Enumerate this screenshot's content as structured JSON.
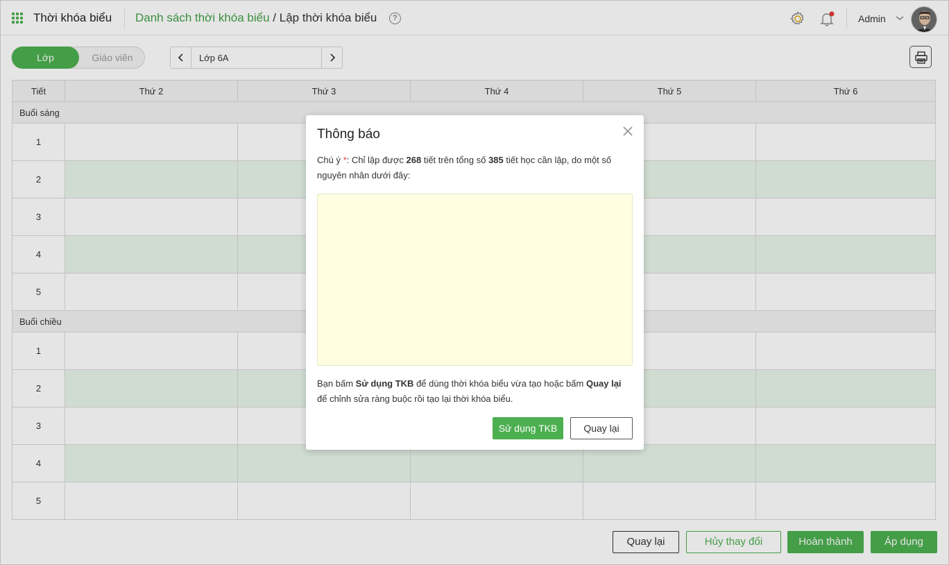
{
  "header": {
    "app_title": "Thời khóa biểu",
    "breadcrumb_link": "Danh sách thời khóa biểu",
    "breadcrumb_sep": " / ",
    "breadcrumb_current": "Lập thời khóa biểu",
    "help_glyph": "?",
    "user_name": "Admin"
  },
  "toolbar": {
    "toggle_class": "Lớp",
    "toggle_teacher": "Giáo viên",
    "selected_class": "Lớp 6A"
  },
  "table": {
    "columns": [
      "Tiết",
      "Thứ 2",
      "Thứ 3",
      "Thứ 4",
      "Thứ 5",
      "Thứ 6"
    ],
    "morning_label": "Buổi sáng",
    "afternoon_label": "Buổi chiều",
    "periods": [
      "1",
      "2",
      "3",
      "4",
      "5"
    ]
  },
  "footer": {
    "back": "Quay lại",
    "cancel_changes": "Hủy thay đổi",
    "finish": "Hoàn thành",
    "apply": "Áp dụng"
  },
  "modal": {
    "title": "Thông báo",
    "note_prefix": "Chú ý ",
    "required_mark": "*",
    "note_part1": ": Chỉ lập được ",
    "scheduled_count": "268",
    "note_part2": " tiết trên tổng số ",
    "total_count": "385",
    "note_part3": " tiết học cần lập, do một số nguyên nhân dưới đây:",
    "hint_part1": "Bạn bấm ",
    "hint_use": "Sử dụng TKB",
    "hint_part2": " để dùng thời khóa biểu vừa tạo hoặc bấm ",
    "hint_back": "Quay lại",
    "hint_part3": " để chỉnh sửa ràng buộc rồi tạo lại thời khóa biểu.",
    "use_button": "Sử dụng TKB",
    "back_button": "Quay lại"
  },
  "colors": {
    "accent": "#4caf50",
    "row_alt": "#e8f5e9",
    "reason_box": "#fffee0",
    "required": "#e53935"
  }
}
